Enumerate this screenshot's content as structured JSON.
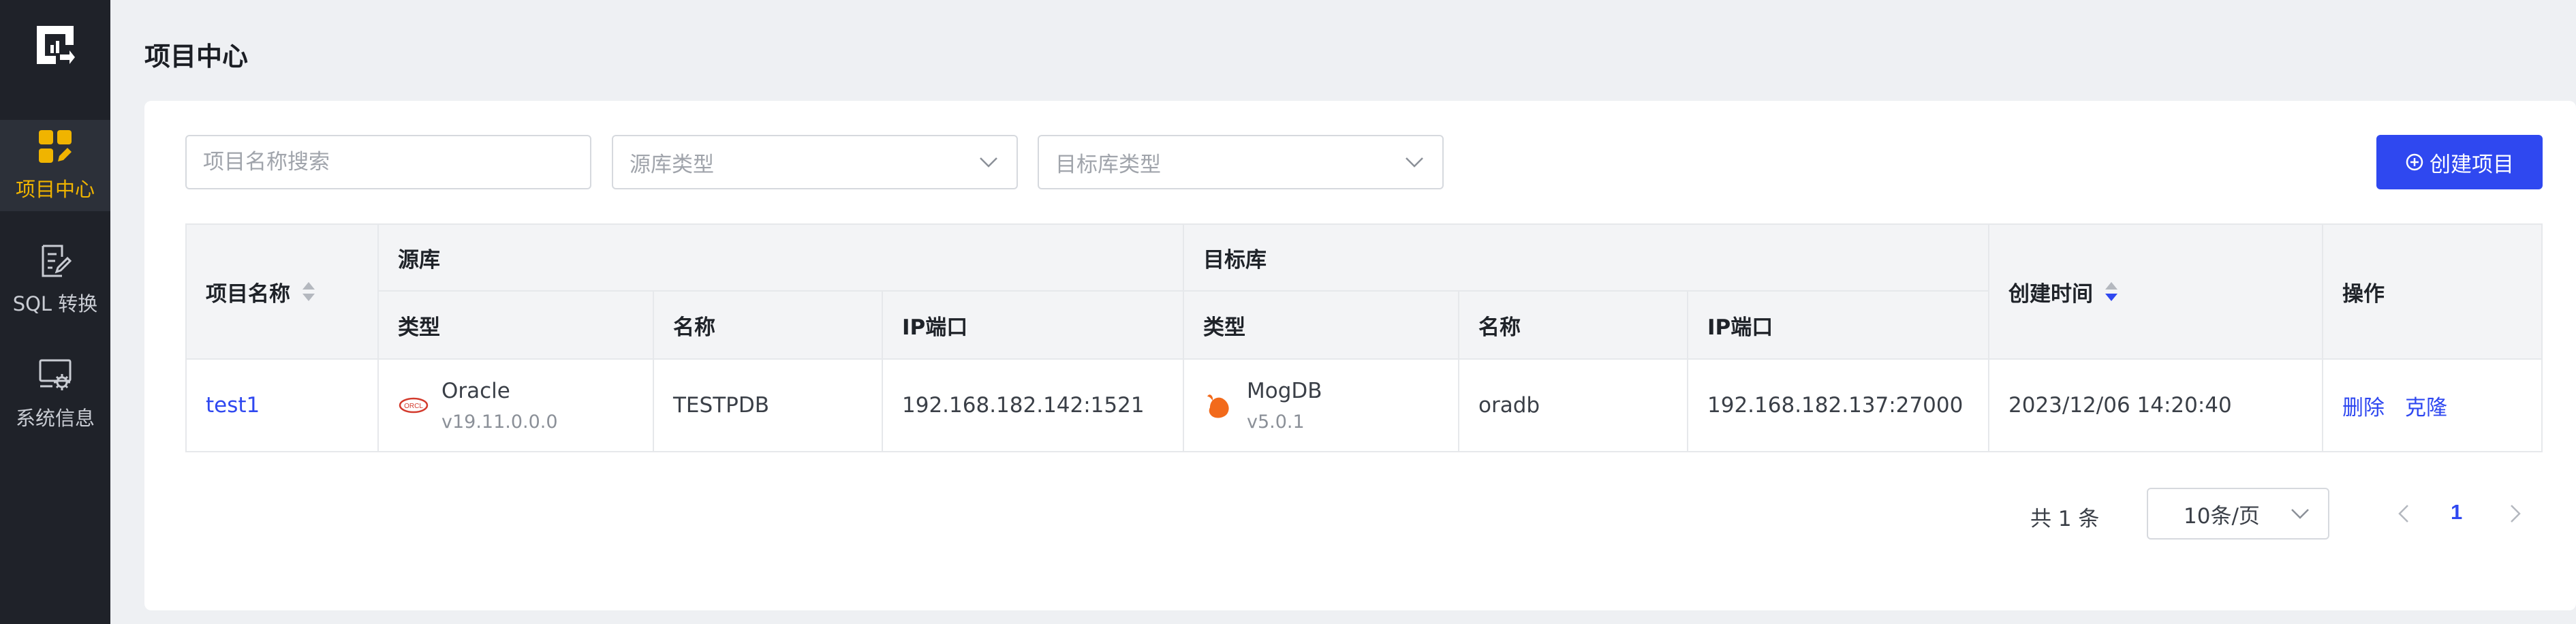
{
  "sidebar": {
    "items": [
      {
        "label": "项目中心",
        "icon": "grid-edit-icon"
      },
      {
        "label": "SQL 转换",
        "icon": "document-edit-icon"
      },
      {
        "label": "系统信息",
        "icon": "settings-panel-icon"
      }
    ],
    "active_color": "#f0b400"
  },
  "header": {
    "title": "项目中心"
  },
  "filters": {
    "search_placeholder": "项目名称搜索",
    "source_type_placeholder": "源库类型",
    "target_type_placeholder": "目标库类型"
  },
  "toolbar": {
    "create_label": "创建项目",
    "create_color": "#2f48f0"
  },
  "table": {
    "headers": {
      "project_name": "项目名称",
      "source": "源库",
      "target": "目标库",
      "created_at": "创建时间",
      "actions": "操作",
      "type": "类型",
      "name": "名称",
      "ip_port": "IP端口"
    },
    "rows": [
      {
        "project_name": "test1",
        "source_type": "Oracle",
        "source_version": "v19.11.0.0.0",
        "source_name": "TESTPDB",
        "source_ip": "192.168.182.142:1521",
        "target_type": "MogDB",
        "target_version": "v5.0.1",
        "target_name": "oradb",
        "target_ip": "192.168.182.137:27000",
        "created_at": "2023/12/06 14:20:40",
        "action_delete": "删除",
        "action_clone": "克隆"
      }
    ]
  },
  "pagination": {
    "total": "共 1 条",
    "page_size": "10条/页",
    "current_page": "1"
  }
}
